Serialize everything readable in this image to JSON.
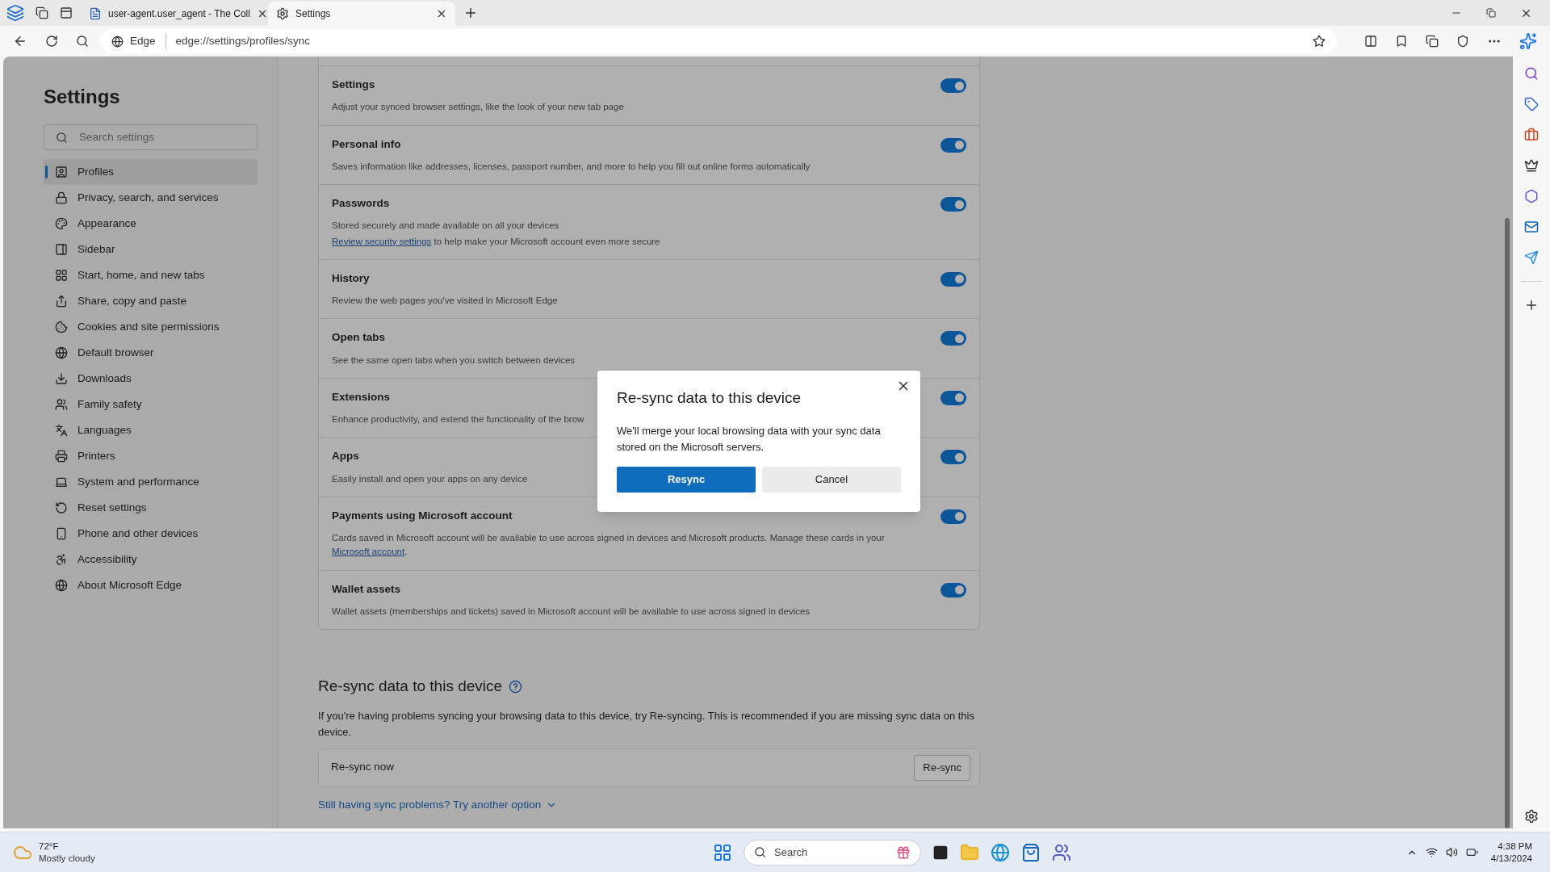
{
  "tabs": [
    {
      "title": "user-agent.user_agent - The Coll",
      "selected": false
    },
    {
      "title": "Settings",
      "selected": true
    }
  ],
  "address_bar": {
    "site_label": "Edge",
    "url": "edge://settings/profiles/sync"
  },
  "sidebar": {
    "title": "Settings",
    "search": {
      "placeholder": "Search settings"
    },
    "items": [
      {
        "label": "Profiles",
        "selected": true
      },
      {
        "label": "Privacy, search, and services",
        "selected": false
      },
      {
        "label": "Appearance",
        "selected": false
      },
      {
        "label": "Sidebar",
        "selected": false
      },
      {
        "label": "Start, home, and new tabs",
        "selected": false
      },
      {
        "label": "Share, copy and paste",
        "selected": false
      },
      {
        "label": "Cookies and site permissions",
        "selected": false
      },
      {
        "label": "Default browser",
        "selected": false
      },
      {
        "label": "Downloads",
        "selected": false
      },
      {
        "label": "Family safety",
        "selected": false
      },
      {
        "label": "Languages",
        "selected": false
      },
      {
        "label": "Printers",
        "selected": false
      },
      {
        "label": "System and performance",
        "selected": false
      },
      {
        "label": "Reset settings",
        "selected": false
      },
      {
        "label": "Phone and other devices",
        "selected": false
      },
      {
        "label": "Accessibility",
        "selected": false
      },
      {
        "label": "About Microsoft Edge",
        "selected": false
      }
    ]
  },
  "sync_items": [
    {
      "title": "Settings",
      "description": "Adjust your synced browser settings, like the look of your new tab page",
      "on": true
    },
    {
      "title": "Personal info",
      "description": "Saves information like addresses, licenses, passport number, and more to help you fill out online forms automatically",
      "on": true
    },
    {
      "title": "Passwords",
      "description": "Stored securely and made available on all your devices",
      "note": {
        "link": "Review security settings",
        "text": " to help make your Microsoft account even more secure"
      },
      "on": true
    },
    {
      "title": "History",
      "description": "Review the web pages you've visited in Microsoft Edge",
      "on": true
    },
    {
      "title": "Open tabs",
      "description": "See the same open tabs when you switch between devices",
      "on": true
    },
    {
      "title": "Extensions",
      "description": "Enhance productivity, and extend the functionality of the brow",
      "on": true
    },
    {
      "title": "Apps",
      "description": "Easily install and open your apps on any device",
      "on": true
    },
    {
      "title": "Payments using Microsoft account",
      "description": "Cards saved in Microsoft account will be available to use across signed in devices and Microsoft products. Manage these cards in your",
      "inline_link": "Microsoft account",
      "after_link": ".",
      "on": true
    },
    {
      "title": "Wallet assets",
      "description": "Wallet assets (memberships and tickets) saved in Microsoft account will be available to use across signed in devices",
      "on": true
    }
  ],
  "resync_section": {
    "heading": "Re-sync data to this device",
    "text": "If you're having problems syncing your browsing data to this device, try Re-syncing. This is recommended if you are missing sync data on this device.",
    "row_label": "Re-sync now",
    "button": "Re-sync",
    "more_link": "Still having sync problems? Try another option"
  },
  "dialog": {
    "title": "Re-sync data to this device",
    "body": "We'll merge your local browsing data with your sync data stored on the Microsoft servers.",
    "primary_button": "Resync",
    "secondary_button": "Cancel"
  },
  "taskbar": {
    "weather": {
      "temperature": "72°F",
      "condition": "Mostly cloudy"
    },
    "search": {
      "placeholder": "Search"
    },
    "time": "4:38 PM",
    "date": "4/13/2024"
  }
}
